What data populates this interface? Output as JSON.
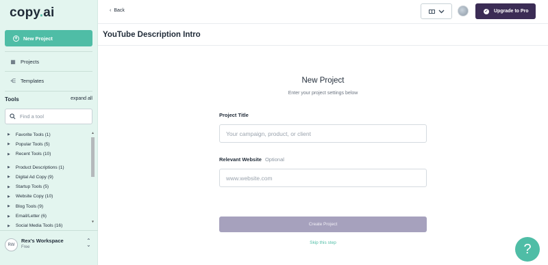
{
  "sidebar": {
    "logo_text": "copy",
    "logo_dot": ".",
    "logo_suffix": "ai",
    "new_project_label": "New Project",
    "nav": [
      {
        "label": "Projects",
        "icon": "grid-icon"
      },
      {
        "label": "Templates",
        "icon": "templates-icon"
      }
    ],
    "tools_title": "Tools",
    "expand_all_label": "expand all",
    "tool_search_placeholder": "Find a tool",
    "tool_groups_a": [
      {
        "label": "Favorite Tools (1)"
      },
      {
        "label": "Popular Tools (5)"
      },
      {
        "label": "Recent Tools (10)"
      }
    ],
    "tool_groups_b": [
      {
        "label": "Product Descriptions (1)"
      },
      {
        "label": "Digital Ad Copy (9)"
      },
      {
        "label": "Startup Tools (5)"
      },
      {
        "label": "Website Copy (10)"
      },
      {
        "label": "Blog Tools (9)"
      },
      {
        "label": "Email/Letter (6)"
      },
      {
        "label": "Social Media Tools (16)"
      }
    ],
    "workspace": {
      "initials": "RW",
      "name": "Rex's Workspace",
      "plan": "Free"
    }
  },
  "topbar": {
    "back_label": "Back",
    "upgrade_label": "Upgrade to Pro"
  },
  "page_title": "YouTube Description Intro",
  "form": {
    "title": "New Project",
    "subtitle": "Enter your project settings below",
    "project_title_label": "Project Title",
    "project_title_placeholder": "Your campaign, product, or client",
    "website_label": "Relevant Website",
    "website_optional": "Optional",
    "website_placeholder": "www.website.com",
    "create_label": "Create Project",
    "skip_label": "Skip this step"
  },
  "help_label": "?",
  "colors": {
    "accent": "#4fbda6",
    "sidebar_bg": "#e3f5ef",
    "upgrade_bg": "#3b2c55",
    "create_disabled": "#a6a1bd"
  }
}
